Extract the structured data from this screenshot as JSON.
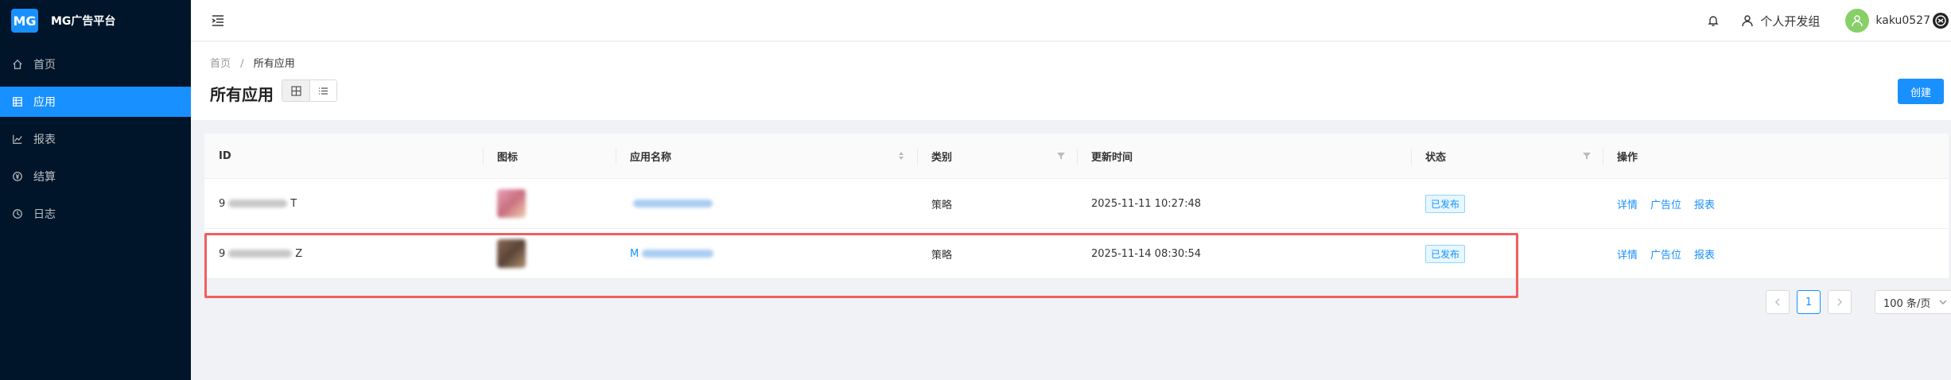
{
  "app": {
    "logo_mark": "MG",
    "title": "MG广告平台"
  },
  "sidebar": {
    "items": [
      {
        "label": "首页",
        "icon": "home-icon"
      },
      {
        "label": "应用",
        "icon": "apps-icon",
        "active": true
      },
      {
        "label": "报表",
        "icon": "chart-icon"
      },
      {
        "label": "结算",
        "icon": "money-icon"
      },
      {
        "label": "日志",
        "icon": "clock-icon"
      }
    ]
  },
  "header": {
    "account_type": "个人开发组",
    "username": "kaku0527"
  },
  "page": {
    "breadcrumb_home": "首页",
    "breadcrumb_sep": "/",
    "breadcrumb_current": "所有应用",
    "title": "所有应用",
    "create_label": "创建"
  },
  "table": {
    "columns": {
      "id": "ID",
      "icon": "图标",
      "name": "应用名称",
      "category": "类别",
      "updated": "更新时间",
      "status": "状态",
      "actions": "操作"
    },
    "rows": [
      {
        "id_prefix": "9",
        "id_suffix": "T",
        "name_visible": "",
        "category": "策略",
        "updated": "2025-11-11 10:27:48",
        "status": "已发布",
        "actions": [
          "详情",
          "广告位",
          "报表"
        ]
      },
      {
        "id_prefix": "9",
        "id_suffix": "Z",
        "name_visible": "M",
        "category": "策略",
        "updated": "2025-11-14 08:30:54",
        "status": "已发布",
        "actions": [
          "详情",
          "广告位",
          "报表"
        ]
      }
    ]
  },
  "pagination": {
    "current_page": "1",
    "page_size": "100 条/页"
  },
  "colors": {
    "sidebar_bg": "#001529",
    "primary": "#1890ff",
    "highlight_border": "#f05f5f",
    "avatar_bg": "#87d068"
  }
}
